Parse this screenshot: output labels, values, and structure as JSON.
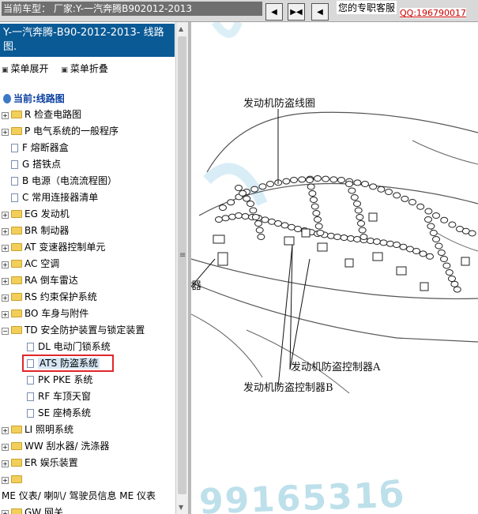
{
  "topbar": {
    "vehicle_text": "当前车型： 厂家:Y-一汽奔腾B902012-2013",
    "nav_prev": "◀",
    "nav_play": "▶◀",
    "nav_next": "◀",
    "customer_service": "您的专职客服",
    "qq": "QQ:196790017"
  },
  "left": {
    "title": "Y-一汽奔腾-B90-2012-2013- 线路图.",
    "expand_label": "菜单展开",
    "collapse_label": "菜单折叠",
    "current_label": "当前:线路图",
    "tree": [
      {
        "kind": "folder",
        "label": "R 检查电路图"
      },
      {
        "kind": "folder",
        "label": "P 电气系统的一般程序"
      },
      {
        "kind": "page",
        "label": "F 熔断器盒"
      },
      {
        "kind": "page",
        "label": "G 搭铁点"
      },
      {
        "kind": "page",
        "label": "B 电源（电流流程图）"
      },
      {
        "kind": "page",
        "label": "C 常用连接器清单"
      },
      {
        "kind": "folder",
        "label": "EG 发动机"
      },
      {
        "kind": "folder",
        "label": "BR 制动器"
      },
      {
        "kind": "folder",
        "label": "AT 变速器控制单元"
      },
      {
        "kind": "folder",
        "label": "AC 空调"
      },
      {
        "kind": "folder",
        "label": "RA 倒车雷达"
      },
      {
        "kind": "folder",
        "label": "RS 约束保护系统"
      },
      {
        "kind": "folder",
        "label": "BO 车身与附件"
      },
      {
        "kind": "folder-open",
        "label": "TD 安全防护装置与锁定装置"
      },
      {
        "kind": "sub-page",
        "label": "DL 电动门锁系统"
      },
      {
        "kind": "sub-page",
        "label": "ATS 防盗系统",
        "selected": true
      },
      {
        "kind": "sub-page",
        "label": "PK PKE 系统"
      },
      {
        "kind": "sub-page",
        "label": "RF 车顶天窗"
      },
      {
        "kind": "sub-page",
        "label": "SE 座椅系统"
      },
      {
        "kind": "folder",
        "label": "LI 照明系统"
      },
      {
        "kind": "folder",
        "label": "WW 刮水器/ 洗涤器"
      },
      {
        "kind": "folder",
        "label": "ER 娱乐装置"
      },
      {
        "kind": "folder",
        "label": ""
      },
      {
        "kind": "text",
        "label": "ME 仪表/ 喇叭/ 驾驶员信息 ME 仪表"
      },
      {
        "kind": "folder",
        "label": "GW 网关"
      }
    ]
  },
  "diagram": {
    "label_coil": "发动机防盗线圈",
    "label_ctrl_a": "发动机防盗控制器A",
    "label_ctrl_b": "发动机防盗控制器B",
    "label_partial": "器",
    "watermark": "9916531б"
  }
}
